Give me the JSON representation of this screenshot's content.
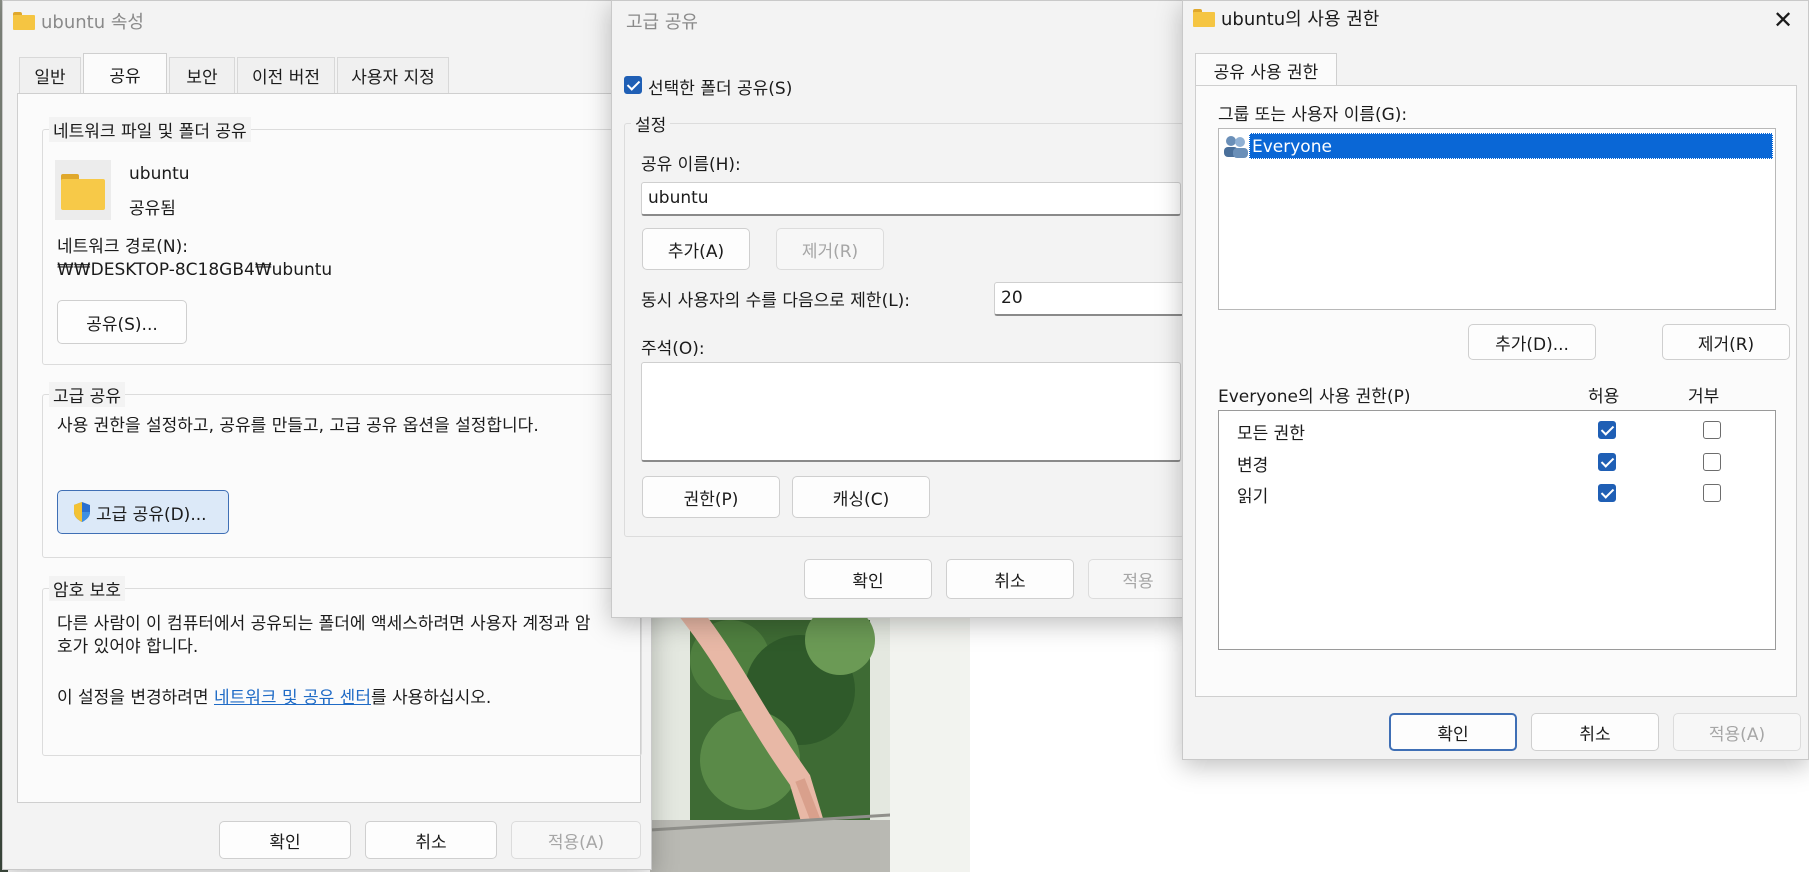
{
  "props": {
    "title": "ubuntu 속성",
    "tabs": [
      "일반",
      "공유",
      "보안",
      "이전 버전",
      "사용자 지정"
    ],
    "share_group": "네트워크 파일 및 폴더 공유",
    "folder_name": "ubuntu",
    "folder_status": "공유됨",
    "network_path_label": "네트워크 경로(N):",
    "network_path": "₩₩DESKTOP-8C18GB4₩ubuntu",
    "share_button": "공유(S)...",
    "adv_group": "고급 공유",
    "adv_desc": "사용 권한을 설정하고, 공유를 만들고, 고급 공유 옵션을 설정합니다.",
    "adv_button": "고급 공유(D)...",
    "pw_group": "암호 보호",
    "pw_desc": "다른 사람이 이 컴퓨터에서 공유되는 폴더에 액세스하려면 사용자 계정과 암호가 있어야 합니다.",
    "pw_change_prefix": "이 설정을 변경하려면 ",
    "pw_link": "네트워크 및 공유 센터",
    "pw_change_suffix": "를 사용하십시오.",
    "ok": "확인",
    "cancel": "취소",
    "apply": "적용(A)"
  },
  "advanced": {
    "title": "고급 공유",
    "share_check": "선택한 폴더 공유(S)",
    "settings_group": "설정",
    "share_name_label": "공유 이름(H):",
    "share_name": "ubuntu",
    "add": "추가(A)",
    "remove": "제거(R)",
    "limit_label": "동시 사용자의 수를 다음으로 제한(L):",
    "limit_value": "20",
    "comment_label": "주석(O):",
    "perm_button": "권한(P)",
    "cache_button": "캐싱(C)",
    "ok": "확인",
    "cancel": "취소",
    "apply": "적용"
  },
  "perms": {
    "title": "ubuntu의 사용 권한",
    "tab": "공유 사용 권한",
    "group_label": "그룹 또는 사용자 이름(G):",
    "users": [
      "Everyone"
    ],
    "add": "추가(D)...",
    "remove": "제거(R)",
    "perm_header": "Everyone의 사용 권한(P)",
    "allow": "허용",
    "deny": "거부",
    "rows": [
      {
        "name": "모든 권한",
        "allow": true,
        "deny": false
      },
      {
        "name": "변경",
        "allow": true,
        "deny": false
      },
      {
        "name": "읽기",
        "allow": true,
        "deny": false
      }
    ],
    "ok": "확인",
    "cancel": "취소",
    "apply": "적용(A)"
  }
}
